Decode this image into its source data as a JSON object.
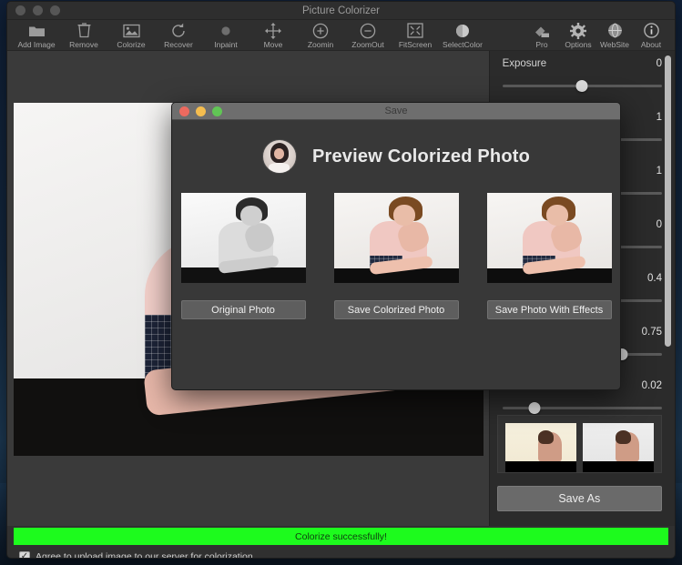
{
  "desktop": {
    "name": "macos-desktop"
  },
  "window": {
    "title": "Picture Colorizer",
    "traffic_lights": [
      "close",
      "minimize",
      "zoom"
    ]
  },
  "toolbar": {
    "left_tools": [
      {
        "label": "Add Image",
        "icon": "folder-icon"
      },
      {
        "label": "Remove",
        "icon": "trash-icon"
      },
      {
        "label": "Colorize",
        "icon": "picture-icon"
      },
      {
        "label": "Recover",
        "icon": "refresh-icon"
      },
      {
        "label": "Inpaint",
        "icon": "brush-dot-icon"
      },
      {
        "label": "Move",
        "icon": "move-arrows-icon"
      },
      {
        "label": "Zoomin",
        "icon": "zoom-in-icon"
      },
      {
        "label": "ZoomOut",
        "icon": "zoom-out-icon"
      },
      {
        "label": "FitScreen",
        "icon": "fit-screen-icon"
      },
      {
        "label": "SelectColor",
        "icon": "color-circle-icon"
      }
    ],
    "right_tools": [
      {
        "label": "Pro",
        "icon": "pro-badge-icon"
      },
      {
        "label": "Options",
        "icon": "gear-icon"
      },
      {
        "label": "WebSite",
        "icon": "globe-icon"
      },
      {
        "label": "About",
        "icon": "info-icon"
      }
    ]
  },
  "sidebar": {
    "sliders": [
      {
        "name": "Exposure",
        "value": "0",
        "knob_percent": 50
      },
      {
        "name": "",
        "value": "1",
        "knob_percent": 50
      },
      {
        "name": "",
        "value": "1",
        "knob_percent": 50
      },
      {
        "name": "",
        "value": "0",
        "knob_percent": 50
      },
      {
        "name": "",
        "value": "0.4",
        "knob_percent": 40
      },
      {
        "name": "",
        "value": "0.75",
        "knob_percent": 75
      },
      {
        "name": "",
        "value": "0.02",
        "knob_percent": 20
      }
    ],
    "thumbnails": [
      {
        "name": "thumbnail-sepia"
      },
      {
        "name": "thumbnail-gray"
      },
      {
        "name": "thumbnail-warm"
      },
      {
        "name": "thumbnail-cool"
      }
    ],
    "save_as_label": "Save As",
    "scrollbar": "vertical-scrollbar"
  },
  "status": {
    "message": "Colorize successfully!",
    "bar_color": "#1dfb1d",
    "agree_label": "Agree to upload image to our server for colorization",
    "agree_checked": true,
    "check_glyph": "✓"
  },
  "dialog": {
    "title": "Save",
    "heading": "Preview Colorized Photo",
    "avatar": "user-avatar",
    "previews": [
      {
        "button_label": "Original Photo",
        "image": "original-bw-photo"
      },
      {
        "button_label": "Save Colorized Photo",
        "image": "colorized-photo"
      },
      {
        "button_label": "Save Photo With Effects",
        "image": "colorized-effects-photo"
      }
    ],
    "traffic_lights": [
      "close",
      "minimize",
      "zoom"
    ]
  }
}
